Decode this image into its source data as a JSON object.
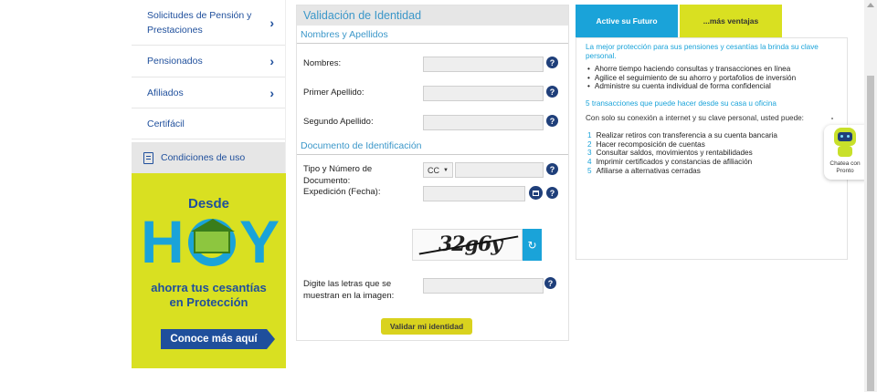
{
  "sidebar": {
    "items": [
      {
        "label": "Solicitudes de Pensión y Prestaciones",
        "chevron": "›"
      },
      {
        "label": "Pensionados",
        "chevron": "›"
      },
      {
        "label": "Afiliados",
        "chevron": "›"
      },
      {
        "label": "Certifácil"
      },
      {
        "label": "Condiciones de uso"
      }
    ]
  },
  "banner": {
    "desde": "Desde",
    "hoy_h": "H",
    "hoy_y": "Y",
    "tagline_1": "ahorra tus cesantías",
    "tagline_2": "en Protección",
    "cta": "Conoce más aquí"
  },
  "form": {
    "title": "Validación de Identidad",
    "section_names": "Nombres y Apellidos",
    "label_nombres": "Nombres:",
    "label_primer": "Primer Apellido:",
    "label_segundo": "Segundo Apellido:",
    "section_doc": "Documento de Identificación",
    "label_tipo": "Tipo y Número de Documento:",
    "doc_type_value": "CC",
    "label_expedicion": "Expedición (Fecha):",
    "captcha_text": "32g6y",
    "label_captcha": "Digite las letras que se muestran en la imagen:",
    "help_glyph": "?",
    "submit": "Validar mi identidad",
    "refresh_glyph": "↻"
  },
  "info": {
    "tab_active": "Active su Futuro",
    "tab_more": "...más ventajas",
    "intro": "La mejor protección para sus pensiones y cesantías la brinda su clave personal.",
    "bullets": [
      "Ahorre tiempo haciendo consultas y transacciones en línea",
      "Agilice el seguimiento de su ahorro y portafolios de inversión",
      "Administre su cuenta individual de forma confidencial"
    ],
    "transactions_head": "5 transacciones que puede hacer desde su casa u oficina",
    "transactions_sub": "Con solo su conexión a internet y su clave personal, usted puede:",
    "transactions": [
      {
        "n": "1",
        "text": "Realizar retiros con transferencia a su cuenta bancaria"
      },
      {
        "n": "2",
        "text": "Hacer recomposición de cuentas"
      },
      {
        "n": "3",
        "text": "Consultar saldos, movimientos y rentabilidades"
      },
      {
        "n": "4",
        "text": "Imprimir certificados y constancias de afiliación"
      },
      {
        "n": "5",
        "text": "Afiliarse a alternativas cerradas"
      }
    ]
  },
  "chatbot": {
    "label_1": "Chatea con",
    "label_2": "Pronto"
  },
  "colors": {
    "accent_blue": "#1aa3d9",
    "navy": "#1f4f9c",
    "lime": "#d9e021",
    "button_yellow": "#d9d21e"
  }
}
